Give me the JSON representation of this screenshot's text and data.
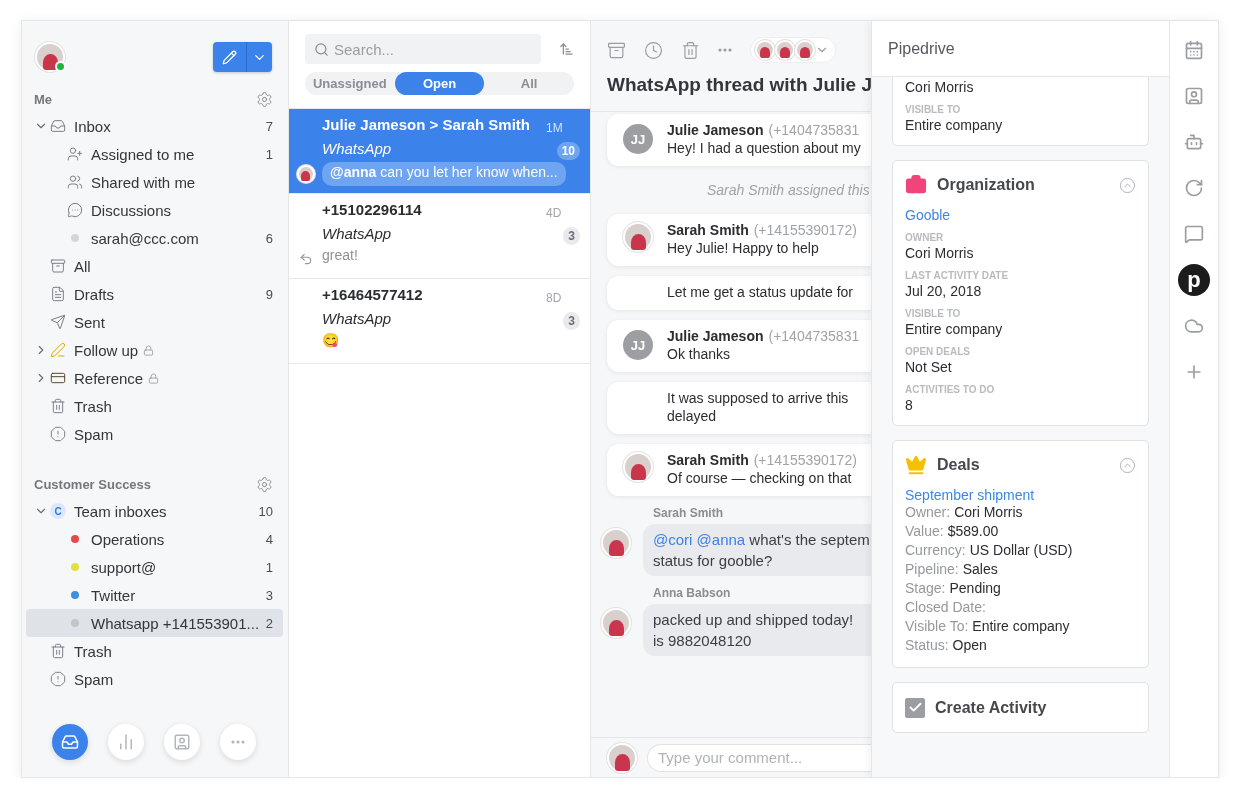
{
  "user": {
    "online": true
  },
  "compose": {
    "selected": false
  },
  "sidebar": {
    "sections": [
      {
        "title": "Me",
        "items": [
          {
            "kind": "inbox",
            "label": "Inbox",
            "count": "7",
            "expanded": true,
            "selected": false,
            "children": [
              {
                "kind": "assigned",
                "label": "Assigned to me",
                "count": "1",
                "selected": false
              },
              {
                "kind": "shared",
                "label": "Shared with me",
                "selected": false
              },
              {
                "kind": "discussions",
                "label": "Discussions",
                "selected": false
              },
              {
                "kind": "dot",
                "label": "sarah@ccc.com",
                "count": "6",
                "color": "#d4d6da",
                "selected": false
              }
            ]
          },
          {
            "kind": "all",
            "label": "All",
            "selected": false
          },
          {
            "kind": "drafts",
            "label": "Drafts",
            "count": "9",
            "selected": false
          },
          {
            "kind": "sent",
            "label": "Sent",
            "selected": false
          },
          {
            "kind": "followup",
            "label": "Follow up",
            "locked": true,
            "expanded": false,
            "selected": false
          },
          {
            "kind": "reference",
            "label": "Reference",
            "locked": true,
            "expanded": false,
            "selected": false
          },
          {
            "kind": "trash",
            "label": "Trash",
            "selected": false
          },
          {
            "kind": "spam",
            "label": "Spam",
            "selected": false
          }
        ]
      },
      {
        "title": "Customer Success",
        "items": [
          {
            "kind": "team",
            "badge": "C",
            "label": "Team inboxes",
            "count": "10",
            "expanded": true,
            "selected": false,
            "children": [
              {
                "kind": "dot",
                "label": "Operations",
                "count": "4",
                "color": "#e5484d",
                "selected": false
              },
              {
                "kind": "dot",
                "label": "support@",
                "count": "1",
                "color": "#e2e23a",
                "selected": false
              },
              {
                "kind": "dot",
                "label": "Twitter",
                "count": "3",
                "color": "#3f8fe0",
                "selected": false
              },
              {
                "kind": "dot",
                "label": "Whatsapp +141553901...",
                "count": "2",
                "color": "#c3c5c9",
                "selected": true
              }
            ]
          },
          {
            "kind": "trash",
            "label": "Trash",
            "selected": false
          },
          {
            "kind": "spam",
            "label": "Spam",
            "selected": false
          }
        ]
      }
    ]
  },
  "bottom_nav": [
    {
      "kind": "inbox",
      "selected": true
    },
    {
      "kind": "reports",
      "selected": false
    },
    {
      "kind": "contacts",
      "selected": false
    },
    {
      "kind": "more",
      "selected": false
    }
  ],
  "search": {
    "placeholder": "Search..."
  },
  "filter_tabs": [
    {
      "label": "Unassigned",
      "selected": false
    },
    {
      "label": "Open",
      "selected": true
    },
    {
      "label": "All",
      "selected": false
    }
  ],
  "conversations": [
    {
      "title": "Julie Jameson > Sarah Smith",
      "time": "1M",
      "channel": "WhatsApp",
      "count": "10",
      "preview": {
        "kind": "mention",
        "text": "**@anna** can you let her know when..."
      },
      "selected": true
    },
    {
      "title": "+15102296114",
      "time": "4D",
      "channel": "WhatsApp",
      "count": "3",
      "preview": {
        "kind": "reply",
        "text": "great!"
      },
      "selected": false
    },
    {
      "title": "+16464577412",
      "time": "8D",
      "channel": "WhatsApp",
      "count": "3",
      "preview": {
        "kind": "emoji",
        "text": "😋"
      },
      "selected": false
    }
  ],
  "thread": {
    "title": "WhatsApp thread with Julie J",
    "composer": {
      "placeholder": "Type your comment..."
    },
    "items": [
      {
        "kind": "message",
        "avatar": {
          "kind": "initials",
          "text": "JJ"
        },
        "author": "Julie Jameson",
        "phone": "(+1404735831",
        "lines": [
          "Hey! I had a question about my"
        ]
      },
      {
        "kind": "event",
        "text": "Sarah Smith assigned this"
      },
      {
        "kind": "message",
        "avatar": {
          "kind": "photo"
        },
        "author": "Sarah Smith",
        "phone": "(+14155390172)",
        "lines": [
          "Hey Julie! Happy to help"
        ]
      },
      {
        "kind": "continuation",
        "lines": [
          "Let me get a status update for"
        ]
      },
      {
        "kind": "message",
        "avatar": {
          "kind": "initials",
          "text": "JJ"
        },
        "author": "Julie Jameson",
        "phone": "(+1404735831",
        "lines": [
          "Ok thanks"
        ]
      },
      {
        "kind": "continuation",
        "lines": [
          "It was supposed to arrive this",
          "delayed"
        ]
      },
      {
        "kind": "message",
        "avatar": {
          "kind": "photo"
        },
        "author": "Sarah Smith",
        "phone": "(+14155390172)",
        "lines": [
          "Of course — checking on that"
        ]
      },
      {
        "kind": "comment",
        "author": "Sarah Smith",
        "mention": "@cori @anna",
        "lines": [
          "what's the septem",
          "status for gooble?"
        ]
      },
      {
        "kind": "comment",
        "author": "Anna Babson",
        "lines": [
          "packed up and shipped today!",
          "is 9882048120"
        ]
      }
    ]
  },
  "panel": {
    "title": "Pipedrive",
    "person_card": {
      "fields": [
        {
          "value": "Cori Morris"
        },
        {
          "label": "VISIBLE TO",
          "value": "Entire company"
        }
      ]
    },
    "organization": {
      "title": "Organization",
      "expanded": true,
      "link": "Gooble",
      "fields": [
        {
          "label": "OWNER",
          "value": "Cori Morris"
        },
        {
          "label": "LAST ACTIVITY DATE",
          "value": "Jul 20, 2018"
        },
        {
          "label": "VISIBLE TO",
          "value": "Entire company"
        },
        {
          "label": "OPEN DEALS",
          "value": "Not Set"
        },
        {
          "label": "ACTIVITIES TO DO",
          "value": "8"
        }
      ]
    },
    "deals": {
      "title": "Deals",
      "expanded": true,
      "link": "September shipment",
      "fields": [
        {
          "label": "Owner:",
          "value": "Cori Morris"
        },
        {
          "label": "Value:",
          "value": "$589.00"
        },
        {
          "label": "Currency:",
          "value": "US Dollar (USD)"
        },
        {
          "label": "Pipeline:",
          "value": "Sales"
        },
        {
          "label": "Stage:",
          "value": "Pending"
        },
        {
          "label": "Closed Date:"
        },
        {
          "label": "Visible To:",
          "value": "Entire company"
        },
        {
          "label": "Status:",
          "value": "Open"
        }
      ]
    },
    "create_activity": {
      "label": "Create Activity",
      "checked": true
    }
  },
  "rail": [
    {
      "kind": "calendar",
      "selected": false
    },
    {
      "kind": "contact",
      "selected": false
    },
    {
      "kind": "mascot",
      "selected": false
    },
    {
      "kind": "refresh",
      "selected": false
    },
    {
      "kind": "chat",
      "selected": false
    },
    {
      "kind": "logo",
      "glyph": "p",
      "selected": true
    },
    {
      "kind": "cloud",
      "selected": false
    },
    {
      "kind": "add",
      "selected": false
    }
  ]
}
